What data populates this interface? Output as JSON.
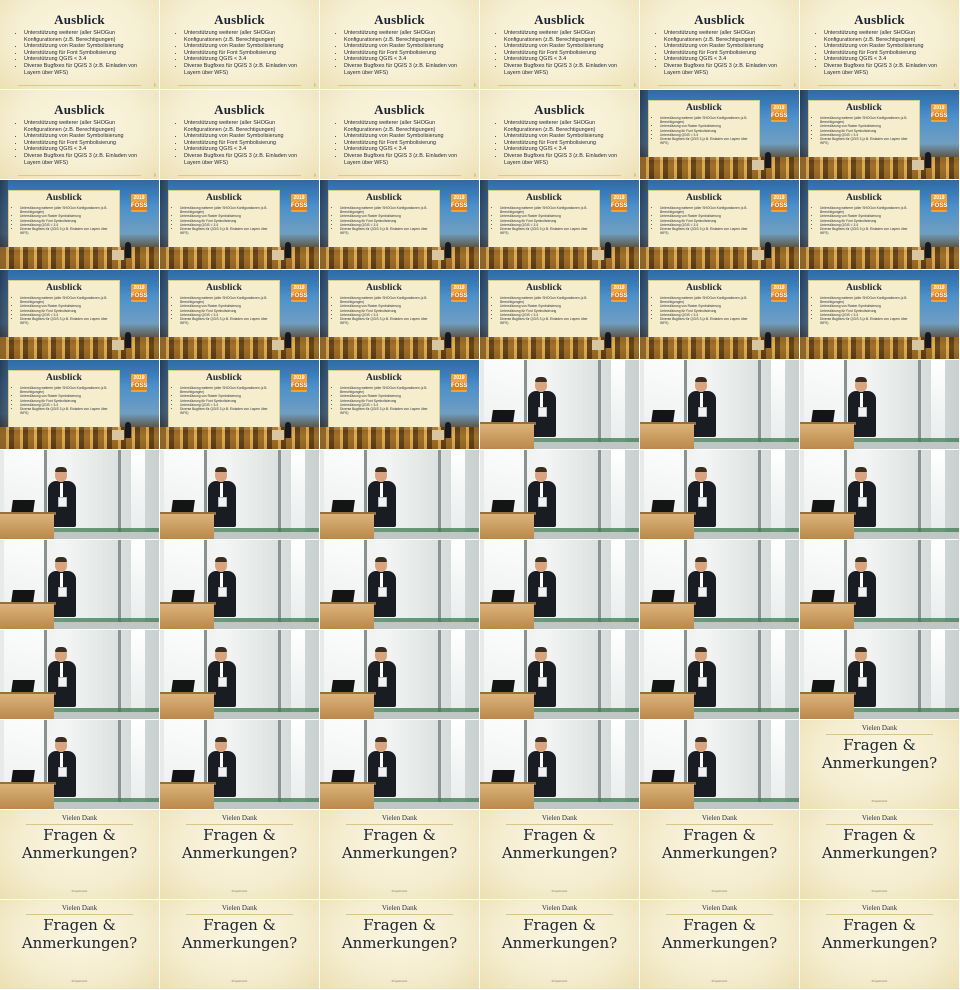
{
  "slide": {
    "title": "Ausblick",
    "bullets": [
      "Unterstützung weiterer (aller SHOGun Konfigurationen (z.B. Berechtigungen)",
      "Unterstützung von Raster Symbolisierung",
      "Unterstützung für Font Symbolisierung",
      "Unterstützung QGIS < 3.4",
      "Diverse Bugfixes für QGIS 3 (z.B. Einladen von Layern über WFS)"
    ]
  },
  "logo": {
    "line1": "2019",
    "line2": "FOSS"
  },
  "closing": {
    "thanks": "Vielen Dank",
    "question": "Fragen & Anmerkungen?",
    "footer": "Projektnotiz"
  },
  "grid": {
    "cols": 6,
    "rows": 11,
    "sequence": [
      "slide",
      "slide",
      "slide",
      "slide",
      "slide",
      "slide",
      "slide",
      "slide",
      "slide",
      "slide",
      "hall",
      "hall",
      "hall",
      "hall",
      "hall",
      "hall",
      "hall",
      "hall",
      "hall",
      "hall",
      "hall",
      "hall",
      "hall",
      "hall",
      "hall",
      "hall",
      "hall",
      "speaker",
      "speaker",
      "speaker",
      "speaker",
      "speaker",
      "speaker",
      "speaker",
      "speaker",
      "speaker",
      "speaker",
      "speaker",
      "speaker",
      "speaker",
      "speaker",
      "speaker",
      "speaker",
      "speaker",
      "speaker",
      "speaker",
      "speaker",
      "speaker",
      "speaker",
      "speaker",
      "speaker",
      "speaker",
      "speaker",
      "fragen",
      "fragen",
      "fragen",
      "fragen",
      "fragen",
      "fragen",
      "fragen",
      "fragen",
      "fragen",
      "fragen",
      "fragen",
      "fragen",
      "fragen"
    ]
  },
  "colors": {
    "parchment": "#f6efd3",
    "ink": "#1d2430",
    "sky": "#3c7fbe",
    "logo_orange": "#f0a23b"
  }
}
